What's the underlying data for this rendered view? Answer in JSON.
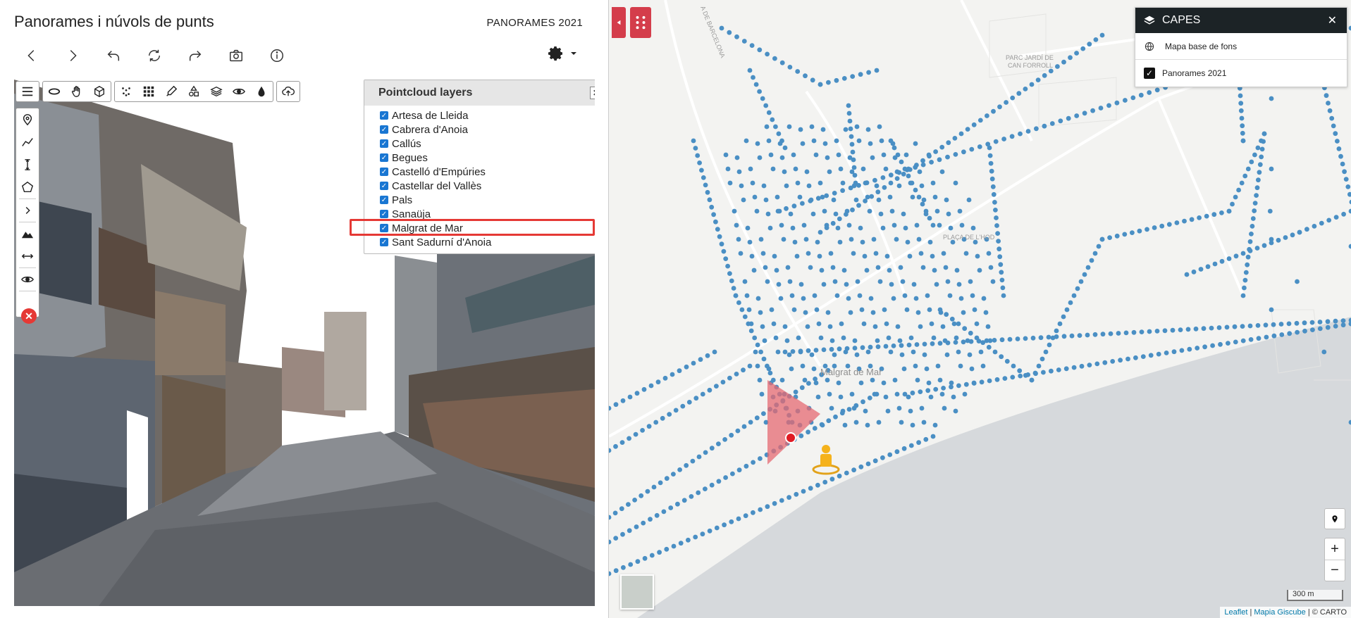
{
  "header": {
    "title": "Panorames i núvols de punts",
    "year_label": "PANORAMES 2021"
  },
  "navbar": {
    "icons": [
      "chevron-left-icon",
      "chevron-right-icon",
      "undo-icon",
      "refresh-icon",
      "redo-icon",
      "camera-icon",
      "info-icon"
    ]
  },
  "pointcloud": {
    "title": "Pointcloud layers",
    "close_label": "✕",
    "items": [
      {
        "label": "Artesa de Lleida",
        "checked": true
      },
      {
        "label": "Cabrera d'Anoia",
        "checked": true
      },
      {
        "label": "Callús",
        "checked": true
      },
      {
        "label": "Begues",
        "checked": true
      },
      {
        "label": "Castelló d'Empúries",
        "checked": true
      },
      {
        "label": "Castellar del Vallès",
        "checked": true
      },
      {
        "label": "Pals",
        "checked": true
      },
      {
        "label": "Sanaüja",
        "checked": true
      },
      {
        "label": "Malgrat de Mar",
        "checked": true
      },
      {
        "label": "Sant Sadurní d'Anoia",
        "checked": true
      }
    ]
  },
  "map": {
    "capes": {
      "title": "CAPES",
      "close_label": "✕",
      "base_layer_label": "Mapa base de fons",
      "layer_label": "Panorames 2021"
    },
    "labels": {
      "road": "A DE BARCELONA",
      "parc": "PARC JARDÍ DE",
      "parc2": "CAN FORROLL",
      "town": "Malgrat de Mar",
      "placa": "PLAÇA DE L'HOD"
    },
    "zoom_in": "+",
    "zoom_out": "−",
    "scale": "300 m",
    "attribution": {
      "leaflet": "Leaflet",
      "sep1": " | ",
      "giscube": "Mapia Giscube",
      "sep2": " | © CARTO"
    },
    "colors": {
      "dots": "#4a8fc4",
      "accent": "#d43d4b",
      "capes_header": "#1c2326"
    }
  }
}
